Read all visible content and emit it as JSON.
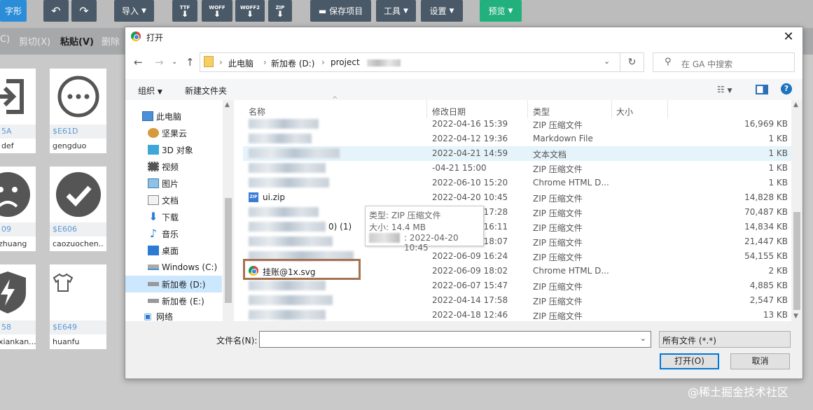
{
  "toolbar": {
    "font_shape": "字形",
    "import": "导入",
    "ttf": "TTF",
    "woff": "WOFF",
    "woff2": "WOFF2",
    "zip": "ZIP",
    "save_project": "保存项目",
    "tools": "工具",
    "settings": "设置",
    "preview": "预览"
  },
  "editbar": {
    "cut": "剪切(X)",
    "paste": "粘贴(V)",
    "delete": "删除",
    "left_partial": "C)"
  },
  "glyphs": [
    {
      "code": "5A",
      "name": "def"
    },
    {
      "code": "$E61D",
      "name": "gengduo"
    },
    {
      "code": "09",
      "name": "zhuang"
    },
    {
      "code": "$E606",
      "name": "caozuochen..."
    },
    {
      "code": "58",
      "name": "xiankan..."
    },
    {
      "code": "$E649",
      "name": "huanfu"
    }
  ],
  "dialog": {
    "title": "打开",
    "path": {
      "this_pc": "此电脑",
      "drive": "新加卷 (D:)",
      "folder": "project"
    },
    "search_placeholder": "在 GA 中搜索",
    "organize": "组织",
    "new_folder": "新建文件夹",
    "nav": [
      {
        "label": "此电脑",
        "icon": "computer-icon"
      },
      {
        "label": "坚果云",
        "icon": "nut-cloud-icon"
      },
      {
        "label": "3D 对象",
        "icon": "3d-objects-icon"
      },
      {
        "label": "视频",
        "icon": "video-icon"
      },
      {
        "label": "图片",
        "icon": "picture-icon"
      },
      {
        "label": "文档",
        "icon": "document-icon"
      },
      {
        "label": "下载",
        "icon": "download-icon"
      },
      {
        "label": "音乐",
        "icon": "music-icon"
      },
      {
        "label": "桌面",
        "icon": "desktop-icon"
      },
      {
        "label": "Windows (C:)",
        "icon": "drive-c-icon"
      },
      {
        "label": "新加卷 (D:)",
        "icon": "drive-d-icon"
      },
      {
        "label": "新加卷 (E:)",
        "icon": "drive-e-icon"
      },
      {
        "label": "网络",
        "icon": "network-icon"
      }
    ],
    "columns": {
      "name": "名称",
      "date": "修改日期",
      "type": "类型",
      "size": "大小"
    },
    "files": [
      {
        "name": "",
        "date": "2022-04-16 15:39",
        "type": "ZIP 压缩文件",
        "size": "16,969 KB",
        "kind": "zip"
      },
      {
        "name": "",
        "date": "2022-04-12 19:36",
        "type": "Markdown File",
        "size": "1 KB",
        "kind": "md"
      },
      {
        "name": "",
        "date": "2022-04-21 14:59",
        "type": "文本文档",
        "size": "1 KB",
        "kind": "txt"
      },
      {
        "name": "",
        "date": "-04-21 15:00",
        "type": "ZIP 压缩文件",
        "size": "1 KB",
        "kind": "zip"
      },
      {
        "name": "",
        "date": "2022-06-10 15:20",
        "type": "Chrome HTML D...",
        "size": "1 KB",
        "kind": "html"
      },
      {
        "name": "ui.zip",
        "date": "2022-04-20 10:45",
        "type": "ZIP 压缩文件",
        "size": "14,828 KB",
        "kind": "zip"
      },
      {
        "name": "",
        "date": "2022-06-08 17:28",
        "type": "ZIP 压缩文件",
        "size": "70,487 KB",
        "kind": "zip"
      },
      {
        "name": "0)  (1)",
        "date": "2022-04-16 16:11",
        "type": "ZIP 压缩文件",
        "size": "14,834 KB",
        "kind": "zip"
      },
      {
        "name": "",
        "date": "2022-06-08 18:07",
        "type": "ZIP 压缩文件",
        "size": "21,447 KB",
        "kind": "zip"
      },
      {
        "name": "",
        "date": "2022-06-09 16:24",
        "type": "ZIP 压缩文件",
        "size": "54,155 KB",
        "kind": "zip"
      },
      {
        "name": "挂账@1x.svg",
        "date": "2022-06-09 18:02",
        "type": "Chrome HTML D...",
        "size": "2 KB",
        "kind": "html"
      },
      {
        "name": "",
        "date": "2022-06-07 15:47",
        "type": "ZIP 压缩文件",
        "size": "4,885 KB",
        "kind": "zip"
      },
      {
        "name": "",
        "date": "2022-04-14 17:58",
        "type": "ZIP 压缩文件",
        "size": "2,547 KB",
        "kind": "zip"
      },
      {
        "name": "",
        "date": "2022-04-18 12:46",
        "type": "ZIP 压缩文件",
        "size": "13 KB",
        "kind": "zip"
      }
    ],
    "tooltip": {
      "type": "类型: ZIP 压缩文件",
      "size": "大小: 14.4 MB",
      "date": ": 2022-04-20 10:45"
    },
    "filename_label": "文件名(N):",
    "filename_value": "",
    "filetype": "所有文件 (*.*)",
    "open": "打开(O)",
    "cancel": "取消"
  },
  "watermark": "@稀土掘金技术社区"
}
